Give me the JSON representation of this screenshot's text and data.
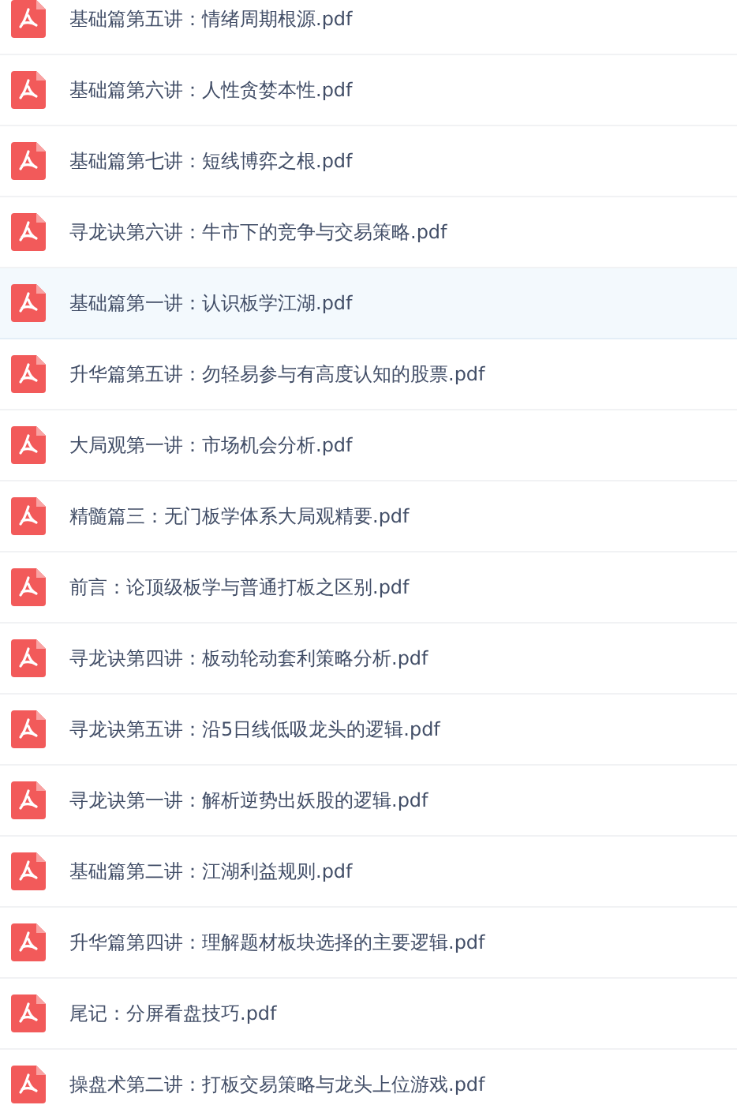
{
  "files": [
    {
      "name": "基础篇第五讲：情绪周期根源.pdf",
      "selected": false
    },
    {
      "name": "基础篇第六讲：人性贪婪本性.pdf",
      "selected": false
    },
    {
      "name": "基础篇第七讲：短线博弈之根.pdf",
      "selected": false
    },
    {
      "name": "寻龙诀第六讲：牛市下的竞争与交易策略.pdf",
      "selected": false
    },
    {
      "name": "基础篇第一讲：认识板学江湖.pdf",
      "selected": true
    },
    {
      "name": "升华篇第五讲：勿轻易参与有高度认知的股票.pdf",
      "selected": false
    },
    {
      "name": "大局观第一讲：市场机会分析.pdf",
      "selected": false
    },
    {
      "name": "精髓篇三：无门板学体系大局观精要.pdf",
      "selected": false
    },
    {
      "name": "前言：论顶级板学与普通打板之区别.pdf",
      "selected": false
    },
    {
      "name": "寻龙诀第四讲：板动轮动套利策略分析.pdf",
      "selected": false
    },
    {
      "name": "寻龙诀第五讲：沿5日线低吸龙头的逻辑.pdf",
      "selected": false
    },
    {
      "name": "寻龙诀第一讲：解析逆势出妖股的逻辑.pdf",
      "selected": false
    },
    {
      "name": "基础篇第二讲：江湖利益规则.pdf",
      "selected": false
    },
    {
      "name": "升华篇第四讲：理解题材板块选择的主要逻辑.pdf",
      "selected": false
    },
    {
      "name": "尾记：分屏看盘技巧.pdf",
      "selected": false
    },
    {
      "name": "操盘术第二讲：打板交易策略与龙头上位游戏.pdf",
      "selected": false
    }
  ]
}
